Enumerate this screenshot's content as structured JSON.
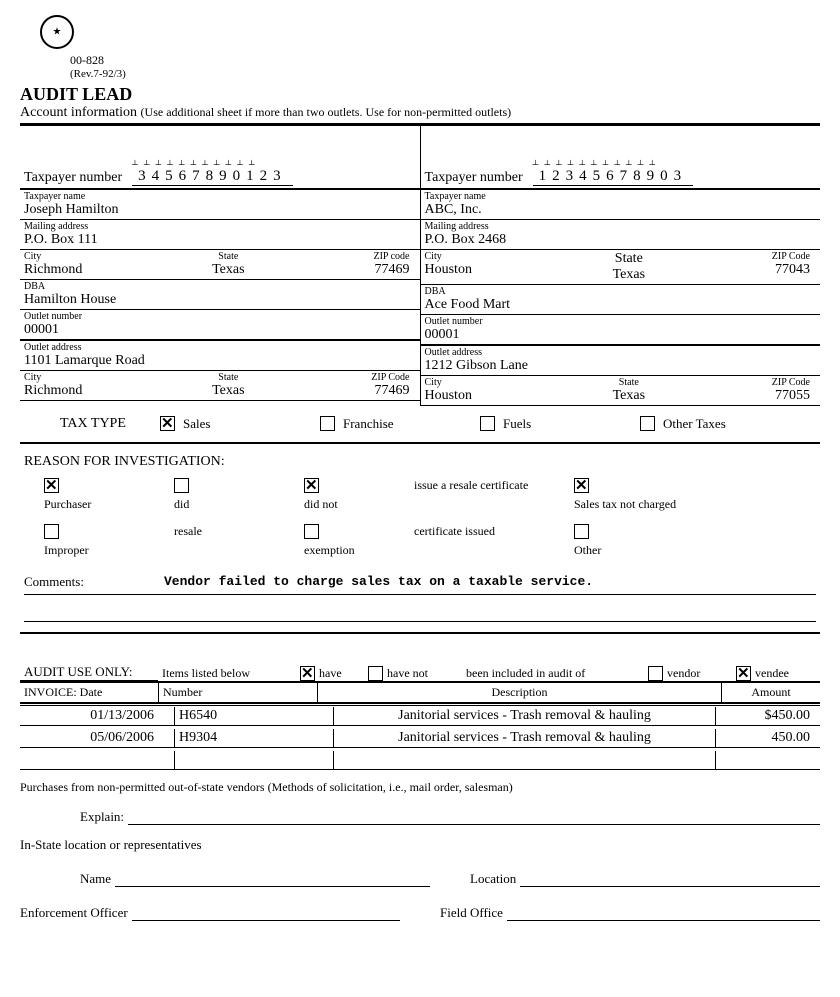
{
  "header": {
    "form_number": "00-828",
    "revision": "(Rev.7-92/3)",
    "title": "AUDIT LEAD",
    "subtitle": "Account information",
    "subtitle_note": "(Use additional sheet if more than two outlets.  Use for non-permitted outlets)"
  },
  "left": {
    "taxpayer_number_label": "Taxpayer number",
    "taxpayer_number": "34567890123",
    "name_label": "Taxpayer name",
    "name": "Joseph Hamilton",
    "mailing_label": "Mailing address",
    "mailing": "P.O. Box 111",
    "city_label": "City",
    "city": "Richmond",
    "state_label": "State",
    "state": "Texas",
    "zip_label": "ZIP code",
    "zip": "77469",
    "dba_label": "DBA",
    "dba": "Hamilton House",
    "outlet_num_label": "Outlet number",
    "outlet_num": "00001",
    "outlet_addr_label": "Outlet address",
    "outlet_addr": "1101 Lamarque Road",
    "o_city_label": "City",
    "o_city": "Richmond",
    "o_state_label": "State",
    "o_state": "Texas",
    "o_zip_label": "ZIP Code",
    "o_zip": "77469"
  },
  "right": {
    "taxpayer_number_label": "Taxpayer number",
    "taxpayer_number": "12345678903",
    "name_label": "Taxpayer name",
    "name": "ABC, Inc.",
    "mailing_label": "Mailing address",
    "mailing": "P.O. Box 2468",
    "city_label": "City",
    "city": "Houston",
    "state_label": "State",
    "state": "Texas",
    "zip_label": "ZIP Code",
    "zip": "77043",
    "dba_label": "DBA",
    "dba": "Ace Food Mart",
    "outlet_num_label": "Outlet number",
    "outlet_num": "00001",
    "outlet_addr_label": "Outlet address",
    "outlet_addr": "1212 Gibson Lane",
    "o_city_label": "City",
    "o_city": "Houston",
    "o_state_label": "State",
    "o_state": "Texas",
    "o_zip_label": "ZIP Code",
    "o_zip": "77055"
  },
  "tax_type": {
    "label": "TAX TYPE",
    "options": {
      "sales": "Sales",
      "franchise": "Franchise",
      "fuels": "Fuels",
      "other": "Other Taxes"
    },
    "checked": "sales"
  },
  "reason": {
    "title": "REASON FOR INVESTIGATION:",
    "row1": {
      "purchaser": "Purchaser",
      "did": "did",
      "did_not": "did not",
      "issue": "issue a resale certificate",
      "not_charged": "Sales tax not charged"
    },
    "row2": {
      "improper": "Improper",
      "resale": "resale",
      "exemption": "exemption",
      "issued": "certificate issued",
      "other": "Other"
    },
    "comments_label": "Comments:",
    "comments": "Vendor failed to charge sales tax on a taxable service."
  },
  "audit": {
    "use_only": "AUDIT USE ONLY:",
    "items_below": "Items listed below",
    "have": "have",
    "have_not": "have not",
    "included": "been included in audit of",
    "vendor": "vendor",
    "vendee": "vendee",
    "headers": {
      "invoice_date": "INVOICE:   Date",
      "number": "Number",
      "description": "Description",
      "amount": "Amount"
    },
    "rows": [
      {
        "date": "01/13/2006",
        "number": "H6540",
        "description": "Janitorial services - Trash removal & hauling",
        "amount": "$450.00"
      },
      {
        "date": "05/06/2006",
        "number": "H9304",
        "description": "Janitorial services - Trash removal & hauling",
        "amount": "450.00"
      }
    ]
  },
  "bottom": {
    "purch_note": "Purchases from non-permitted out-of-state vendors (Methods of solicitation, i.e., mail order, salesman)",
    "explain": "Explain:",
    "instate": "In-State location or representatives",
    "name": "Name",
    "location": "Location",
    "officer": "Enforcement Officer",
    "field": "Field Office"
  }
}
